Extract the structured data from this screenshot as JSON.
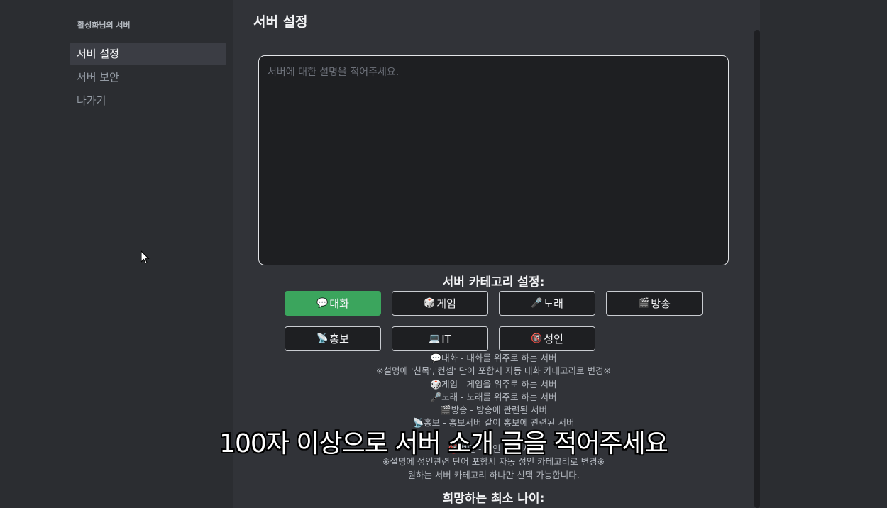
{
  "sidebar": {
    "server_name": "활성화님의 서버",
    "items": [
      {
        "label": "서버 설정"
      },
      {
        "label": "서버 보안"
      },
      {
        "label": "나가기"
      }
    ]
  },
  "main": {
    "title": "서버 설정",
    "description_placeholder": "서버에 대한 설명을 적어주세요.",
    "category_title": "서버 카테고리 설정:",
    "categories": [
      {
        "icon": "💬",
        "label": "대화"
      },
      {
        "icon": "🎲",
        "label": "게임"
      },
      {
        "icon": "🎤",
        "label": "노래"
      },
      {
        "icon": "🎬",
        "label": "방송"
      },
      {
        "icon": "📡",
        "label": "홍보"
      },
      {
        "icon": "💻",
        "label": "IT"
      },
      {
        "icon": "🔞",
        "label": "성인"
      }
    ],
    "info_lines": [
      "💬대화 - 대화를 위주로 하는 서버",
      "※설명에 '친목','컨셉' 단어 포함시 자동 대화 카테고리로 변경※",
      "🎲게임 - 게임을 위주로 하는 서버",
      "🎤노래 - 노래를 위주로 하는 서버",
      "🎬방송 - 방송에 관련된 서버",
      "📡홍보 - 홍보서버 같이 홍보에 관련된 서버",
      "",
      "🔞성인 - 성인 관련 서버",
      "※설명에 성인관련 단어 포함시 자동 성인 카테고리로 변경※",
      "원하는 서버 카테고리 하나만 선택 가능합니다."
    ],
    "age_title": "희망하는 최소 나이:"
  },
  "subtitle": "100자 이상으로 서버 소개 글을 적어주세요",
  "colors": {
    "selected": "#3ba55d",
    "content_bg": "#313338",
    "sidebar_bg": "#2b2d31"
  }
}
